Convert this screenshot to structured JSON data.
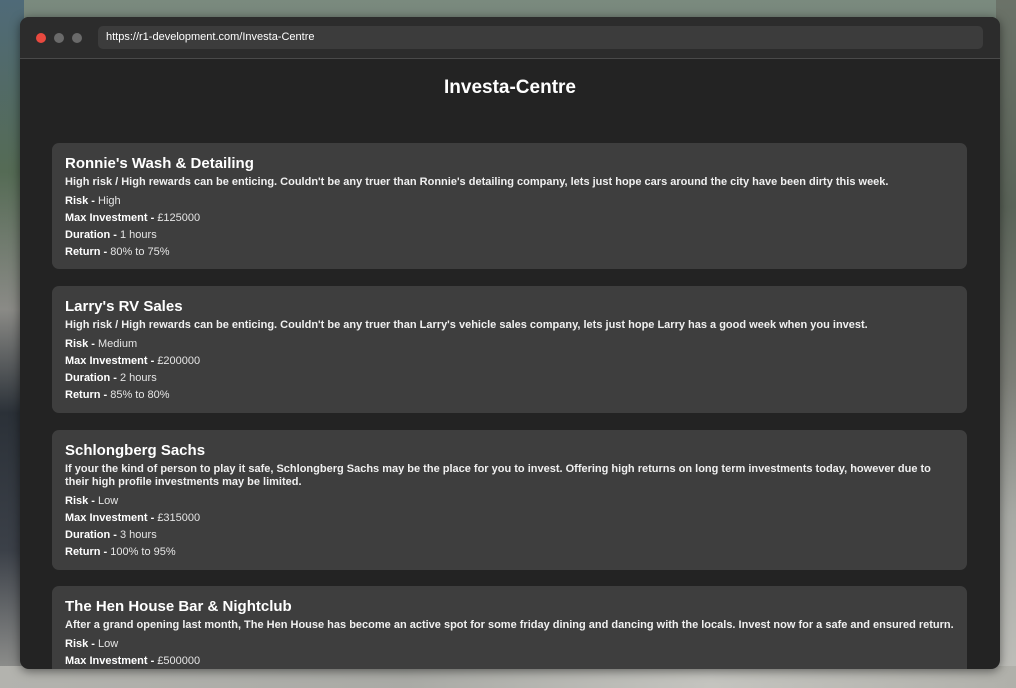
{
  "browser": {
    "url": "https://r1-development.com/Investa-Centre"
  },
  "page": {
    "title": "Investa-Centre"
  },
  "labels": {
    "risk": "Risk - ",
    "max_investment": "Max Investment - ",
    "duration": "Duration - ",
    "return": "Return - "
  },
  "investments": [
    {
      "name": "Ronnie's Wash & Detailing",
      "description": "High risk / High rewards can be enticing. Couldn't be any truer than Ronnie's detailing company, lets just hope cars around the city have been dirty this week.",
      "risk": "High",
      "max_investment": "£125000",
      "duration": "1 hours",
      "return": "80% to 75%"
    },
    {
      "name": "Larry's RV Sales",
      "description": "High risk / High rewards can be enticing. Couldn't be any truer than Larry's vehicle sales company, lets just hope Larry has a good week when you invest.",
      "risk": "Medium",
      "max_investment": "£200000",
      "duration": "2 hours",
      "return": "85% to 80%"
    },
    {
      "name": "Schlongberg Sachs",
      "description": "If your the kind of person to play it safe, Schlongberg Sachs may be the place for you to invest. Offering high returns on long term investments today, however due to their high profile investments may be limited.",
      "risk": "Low",
      "max_investment": "£315000",
      "duration": "3 hours",
      "return": "100% to 95%"
    },
    {
      "name": "The Hen House Bar & Nightclub",
      "description": "After a grand opening last month, The Hen House has become an active spot for some friday dining and dancing with the locals. Invest now for a safe and ensured return.",
      "risk": "Low",
      "max_investment": "£500000"
    }
  ]
}
